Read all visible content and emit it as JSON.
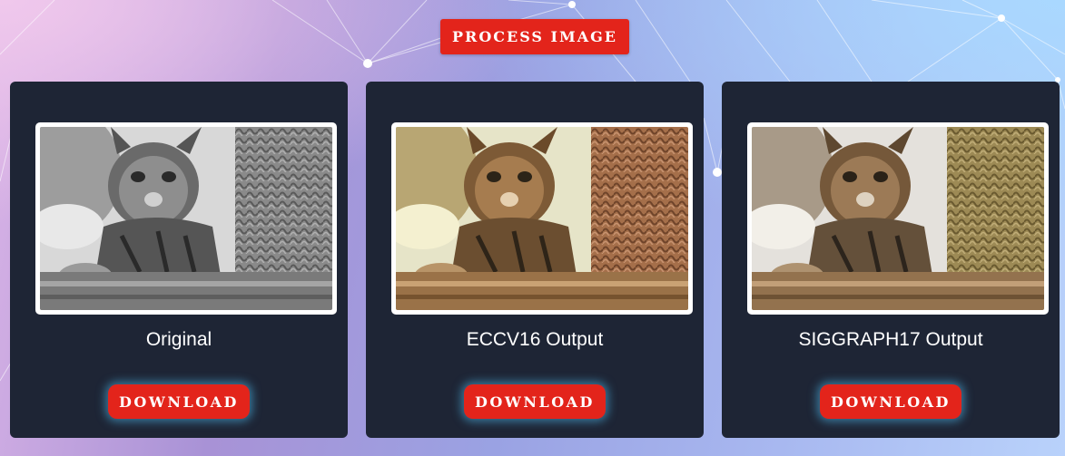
{
  "toolbar": {
    "process_label": "PROCESS IMAGE"
  },
  "cards": [
    {
      "caption": "Original",
      "download_label": "DOWNLOAD",
      "filter": "grayscale"
    },
    {
      "caption": "ECCV16 Output",
      "download_label": "DOWNLOAD",
      "filter": "warm-color"
    },
    {
      "caption": "SIGGRAPH17 Output",
      "download_label": "DOWNLOAD",
      "filter": "natural-color"
    }
  ],
  "colors": {
    "accent": "#e3241b",
    "card_bg": "#1e2535",
    "glow": "#50bef0"
  }
}
